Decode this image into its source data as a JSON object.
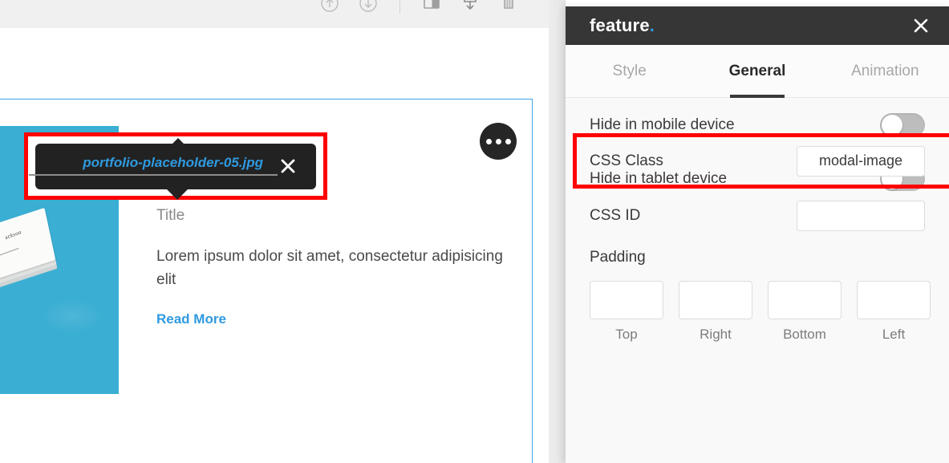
{
  "toolbar": {
    "icons": [
      {
        "name": "move-up-circle-icon",
        "label": "Move Up"
      },
      {
        "name": "move-down-circle-icon",
        "label": "Move Down"
      },
      {
        "name": "layout-icon",
        "label": "Layout"
      },
      {
        "name": "save-download-icon",
        "label": "Save"
      },
      {
        "name": "trash-icon",
        "label": "Delete"
      }
    ]
  },
  "canvas": {
    "widget": {
      "title": "Title",
      "description": "Lorem ipsum dolor sit amet, consectetur adipisicing elit",
      "read_more_label": "Read More",
      "image_alt": "portfolio placeholder business cards",
      "image_bg_color": "#3aaed3",
      "ellipsis_button": "•••"
    },
    "tooltip": {
      "filename": "portfolio-placeholder-05.jpg",
      "close_label": "✕",
      "bg_color": "#222222",
      "text_color": "#2f9ae0"
    },
    "selection_color": "#3da5e8",
    "highlight_color": "#fe0000"
  },
  "modal": {
    "title": "feature",
    "title_dot": ".",
    "close_label": "✕",
    "header_bg": "#363636",
    "accent_color": "#2f9ae0",
    "tabs": [
      {
        "label": "Style",
        "active": false
      },
      {
        "label": "General",
        "active": true
      },
      {
        "label": "Animation",
        "active": false
      }
    ],
    "fields": {
      "hide_mobile": {
        "label": "Hide in mobile device",
        "value": "off"
      },
      "hide_tablet": {
        "label": "Hide in tablet device",
        "value": "off"
      },
      "css_class": {
        "label": "CSS Class",
        "value": "modal-image",
        "placeholder": ""
      },
      "css_id": {
        "label": "CSS ID",
        "value": "",
        "placeholder": ""
      },
      "padding": {
        "label": "Padding",
        "inputs": [
          {
            "caption": "Top",
            "value": "",
            "placeholder": ""
          },
          {
            "caption": "Right",
            "value": "",
            "placeholder": ""
          },
          {
            "caption": "Bottom",
            "value": "",
            "placeholder": ""
          },
          {
            "caption": "Left",
            "value": "",
            "placeholder": ""
          }
        ]
      }
    }
  }
}
